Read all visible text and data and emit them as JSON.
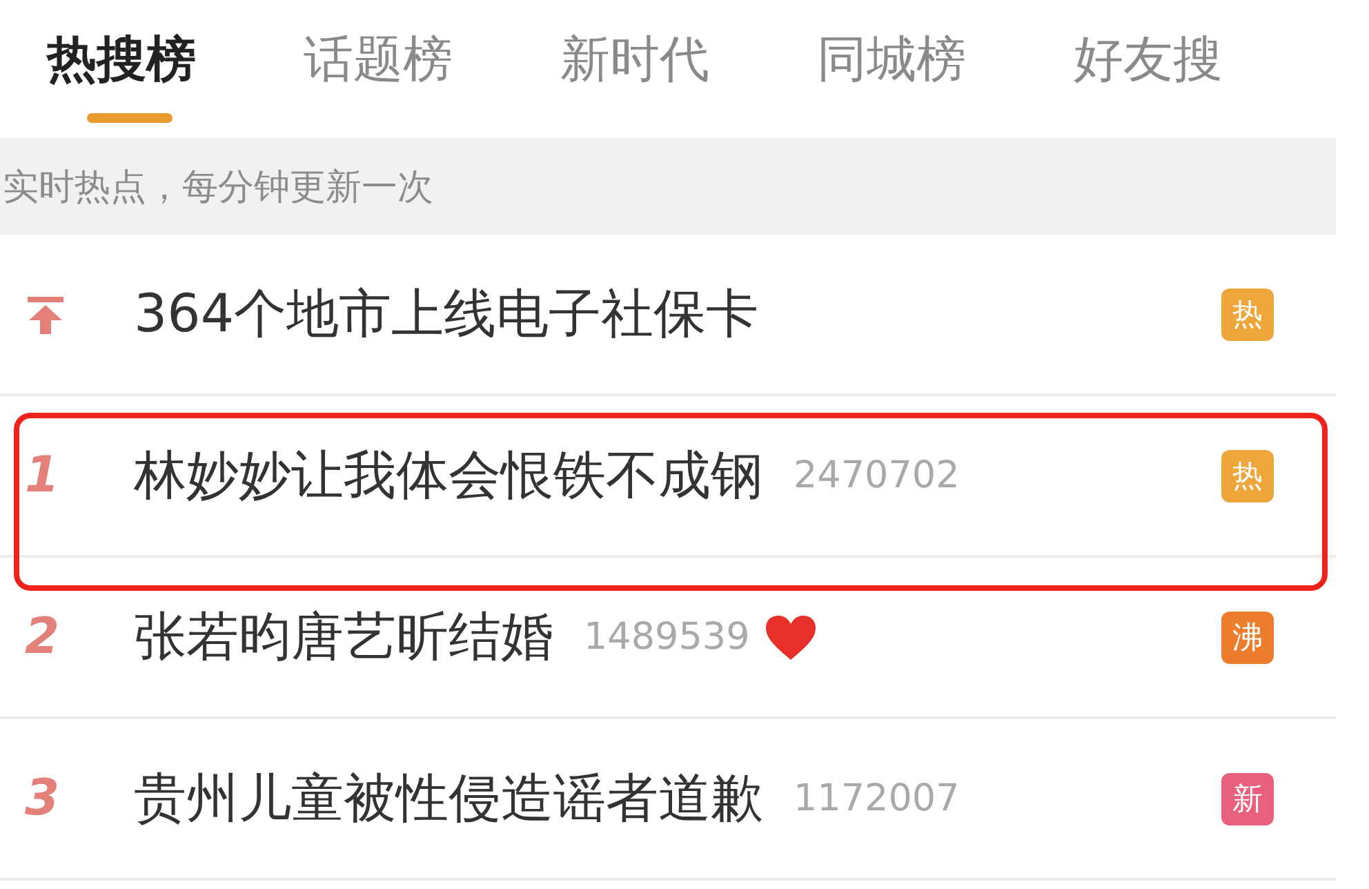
{
  "tabs": [
    {
      "label": "热搜榜",
      "selected": true
    },
    {
      "label": "话题榜",
      "selected": false
    },
    {
      "label": "新时代",
      "selected": false
    },
    {
      "label": "同城榜",
      "selected": false
    },
    {
      "label": "好友搜",
      "selected": false
    }
  ],
  "notice": "实时热点，每分钟更新一次",
  "rows": [
    {
      "kind": "pinned",
      "title": "364个地市上线电子社保卡",
      "badge": "热",
      "color": "#eea53a",
      "highlighted": false,
      "heart": false
    },
    {
      "kind": "ranked",
      "rank": "1",
      "title": "林妙妙让我体会恨铁不成钢",
      "count": "2470702",
      "badge": "热",
      "color": "#eea53a",
      "highlighted": true,
      "heart": false
    },
    {
      "kind": "ranked",
      "rank": "2",
      "title": "张若昀唐艺昕结婚",
      "count": "1489539",
      "badge": "沸",
      "color": "#ec7d2c",
      "highlighted": false,
      "heart": true
    },
    {
      "kind": "ranked",
      "rank": "3",
      "title": "贵州儿童被性侵造谣者道歉",
      "count": "1172007",
      "badge": "新",
      "color": "#e9607e",
      "highlighted": false,
      "heart": false
    }
  ]
}
